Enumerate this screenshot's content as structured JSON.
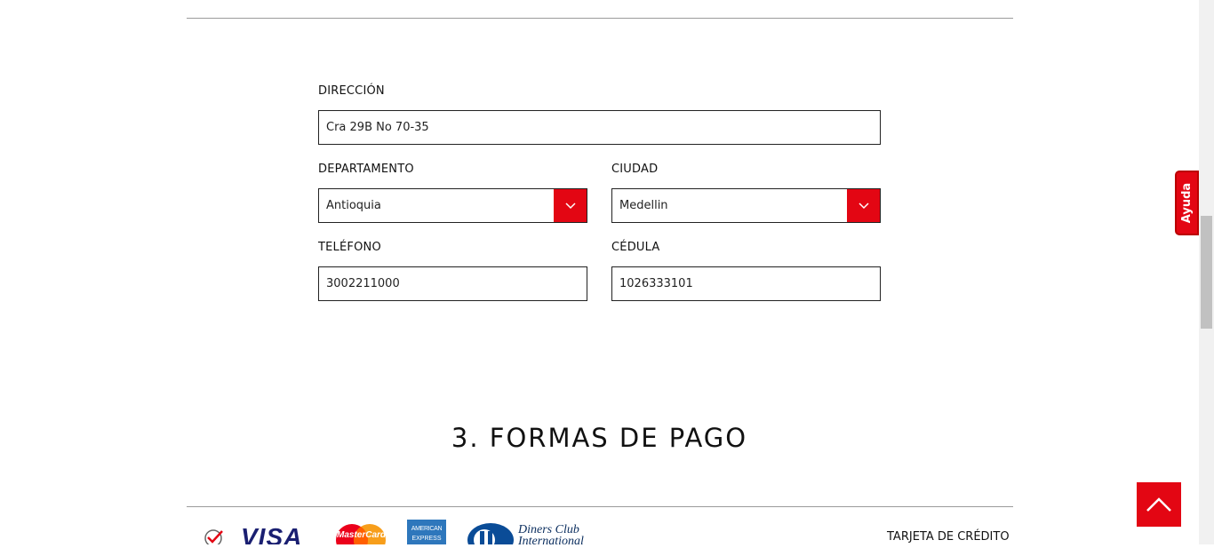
{
  "form": {
    "address": {
      "label": "DIRECCIÓN",
      "value": "Cra 29B No 70-35"
    },
    "department": {
      "label": "DEPARTAMENTO",
      "value": "Antioquia"
    },
    "city": {
      "label": "CIUDAD",
      "value": "Medellin"
    },
    "phone": {
      "label": "TELÉFONO",
      "value": "3002211000"
    },
    "id_number": {
      "label": "CÉDULA",
      "value": "1026333101"
    }
  },
  "payment": {
    "section_title": "3. FORMAS DE PAGO",
    "credit_card_label": "TARJETA DE CRÉDITO",
    "logos": {
      "visa": "VISA",
      "mastercard": "MasterCard",
      "amex_line1": "AMERICAN",
      "amex_line2": "EXPRESS",
      "diners_line1": "Diners Club",
      "diners_line2": "International"
    }
  },
  "help_tab": {
    "label": "Ayuda"
  },
  "colors": {
    "accent": "#e30613",
    "border": "#222222",
    "divider": "#9b9b9b"
  }
}
